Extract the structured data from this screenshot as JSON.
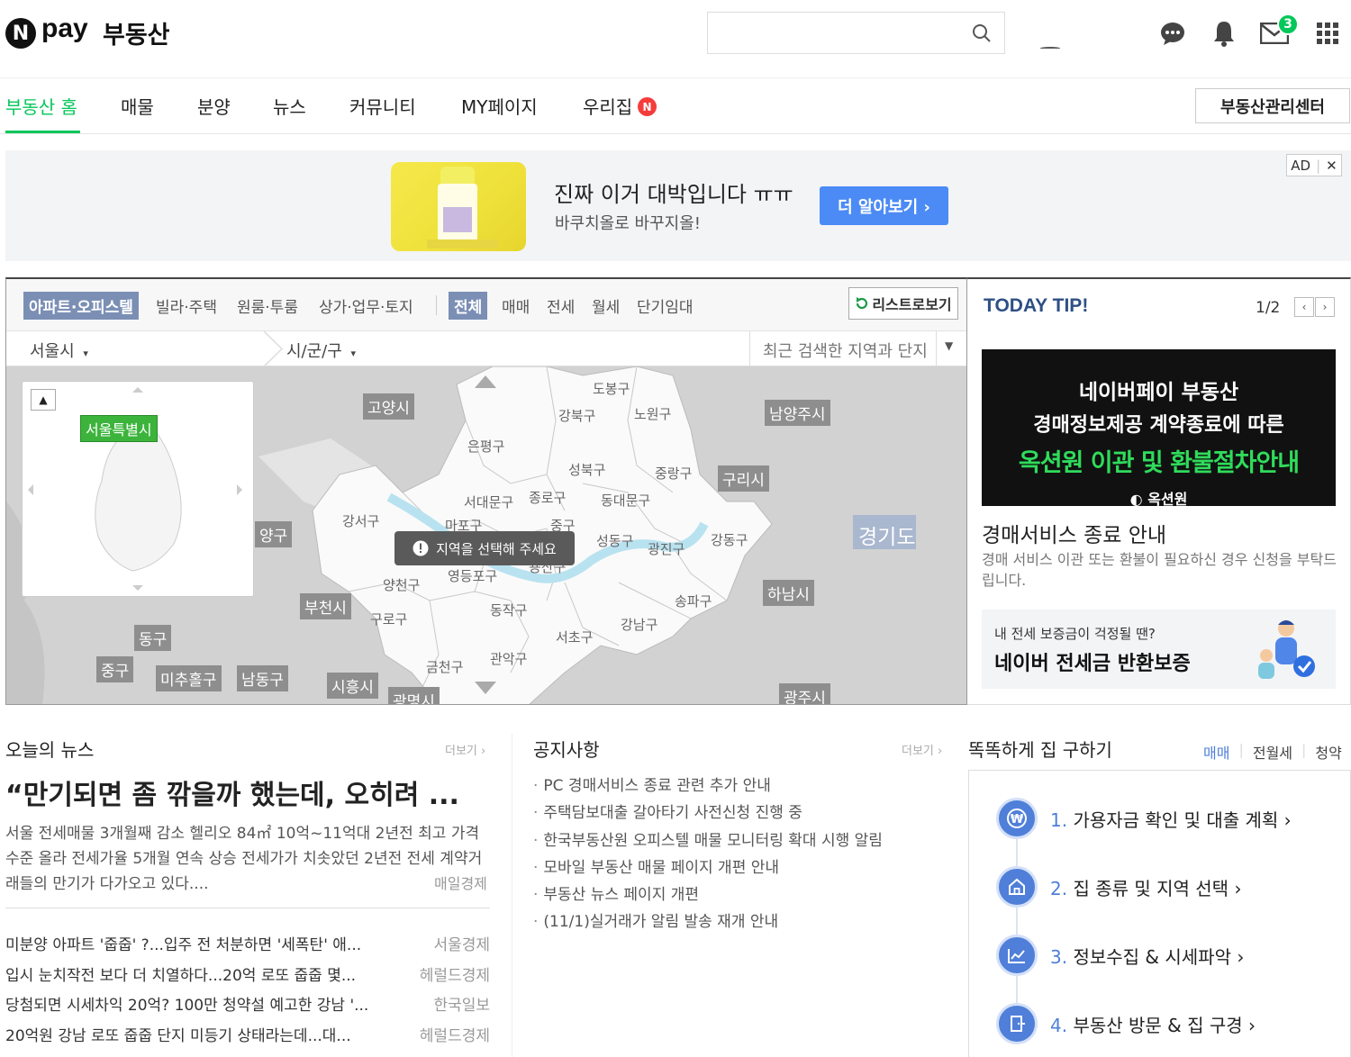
{
  "header": {
    "logo_n": "N",
    "logo_pay": "pay",
    "logo_realty": "부동산",
    "mail_badge": "3",
    "icons": [
      "chat-icon",
      "bell-icon",
      "mail-icon",
      "apps-grid-icon"
    ]
  },
  "nav": {
    "items": [
      "부동산 홈",
      "매물",
      "분양",
      "뉴스",
      "커뮤니티",
      "MY페이지",
      "우리집"
    ],
    "home_badge": "N",
    "mgmt_button": "부동산관리센터"
  },
  "ad": {
    "title": "진짜 이거 대박입니다 ㅠㅠ",
    "subtitle": "바쿠치올로 바꾸지올!",
    "button": "더 알아보기 ›",
    "tag": "AD",
    "close": "✕"
  },
  "map": {
    "property_tabs": [
      "아파트·오피스텔",
      "빌라·주택",
      "원룸·투룸",
      "상가·업무·토지"
    ],
    "deal_tabs": [
      "전체",
      "매매",
      "전세",
      "월세",
      "단기임대"
    ],
    "list_view": "리스트로보기",
    "city_select": "서울시",
    "district_select": "시/군/구",
    "recent_placeholder": "최근 검색한 지역과 단지",
    "minimap_label": "서울특별시",
    "toast": "지역을 선택해 주세요",
    "city_labels": [
      "고양시",
      "남양주시",
      "구리시",
      "경기도",
      "양구",
      "부천시",
      "하남시",
      "동구",
      "중구",
      "미추홀구",
      "남동구",
      "시흥시",
      "광명시",
      "광주시"
    ],
    "gu_labels": [
      "도봉구",
      "강북구",
      "노원구",
      "은평구",
      "성북구",
      "중랑구",
      "서대문구",
      "종로구",
      "동대문구",
      "강서구",
      "마포구",
      "중구",
      "성동구",
      "광진구",
      "강동구",
      "용산구",
      "양천구",
      "영등포구",
      "구로구",
      "동작구",
      "송파구",
      "강남구",
      "서초구",
      "관악구",
      "금천구"
    ]
  },
  "tip": {
    "title": "TODAY TIP!",
    "page": "1/2",
    "prev": "‹",
    "next": "›",
    "banner_line1": "네이버페이 부동산",
    "banner_line2": "경매정보제공 계약종료에 따른",
    "banner_line3": "옥션원 이관 및 환불절차안내",
    "banner_brand": "옥션원",
    "heading": "경매서비스 종료 안내",
    "desc": "경매 서비스 이관 또는 환불이 필요하신 경우 신청을 부탁드립니다.",
    "card_small": "내 전세 보증금이 걱정될 땐?",
    "card_big": "네이버 전세금 반환보증"
  },
  "news": {
    "title": "오늘의 뉴스",
    "more": "더보기 ›",
    "headline": "“만기되면 좀 깎을까 했는데, 오히려 ...",
    "summary": "서울 전세매물 3개월째 감소 헬리오 84㎡ 10억~11억대 2년전 최고 가격 수준 올라 전세가율 5개월 연속 상승 전세가가 치솟았던 2년전 전세 계약거래들의 만기가 다가오고 있다....",
    "summary_source": "매일경제",
    "items": [
      {
        "text": "미분양 아파트 '줍줍' ?...입주 전 처분하면 '세폭탄' 애...",
        "source": "서울경제"
      },
      {
        "text": "입시 눈치작전 보다 더 치열하다...20억 로또 줍줍 몇...",
        "source": "헤럴드경제"
      },
      {
        "text": "당첨되면 시세차익 20억? 100만 청약설 예고한 강남 '...",
        "source": "한국일보"
      },
      {
        "text": "20억원 강남 로또 줍줍 단지 미등기 상태라는데...대...",
        "source": "헤럴드경제"
      }
    ]
  },
  "notice": {
    "title": "공지사항",
    "more": "더보기 ›",
    "items": [
      "PC 경매서비스 종료 관련 추가 안내",
      "주택담보대출 갈아타기 사전신청 진행 중",
      "한국부동산원 오피스텔 매물 모니터링 확대 시행 알림",
      "모바일 부동산 매물 페이지 개편 안내",
      "부동산 뉴스 페이지 개편",
      "(11/1)실거래가 알림 발송 재개 안내"
    ]
  },
  "find_home": {
    "title": "똑똑하게 집 구하기",
    "tabs": [
      "매매",
      "전월세",
      "청약"
    ],
    "steps": [
      {
        "num": "1.",
        "text": "가용자금 확인 및 대출 계획 ›"
      },
      {
        "num": "2.",
        "text": "집 종류 및 지역 선택 ›"
      },
      {
        "num": "3.",
        "text": "정보수집 & 시세파악 ›"
      },
      {
        "num": "4.",
        "text": "부동산 방문 & 집 구경 ›"
      }
    ]
  },
  "colors": {
    "brand_green": "#03c75a",
    "ad_button": "#4c8bf5",
    "tab_selected": "#7b8fb5",
    "step_blue": "#4f7fd9",
    "tip_title": "#2d4f85"
  }
}
